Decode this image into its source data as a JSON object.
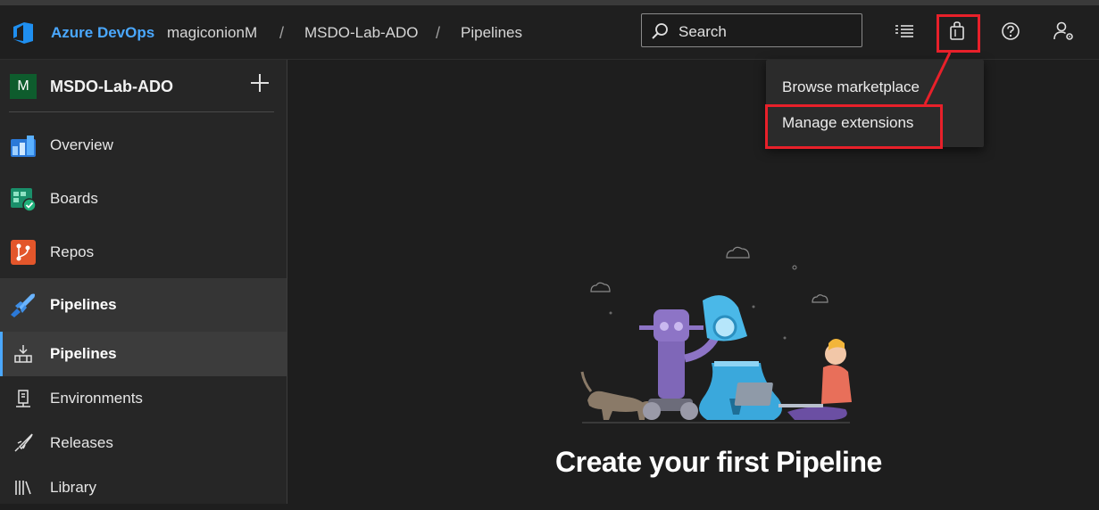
{
  "header": {
    "brand": "Azure DevOps",
    "breadcrumb": [
      "magiconionM",
      "MSDO-Lab-ADO",
      "Pipelines"
    ],
    "search_placeholder": "Search",
    "icons": [
      "task-list-icon",
      "marketplace-bag-icon",
      "help-icon",
      "user-settings-icon"
    ]
  },
  "menu": {
    "items": [
      "Browse marketplace",
      "Manage extensions"
    ]
  },
  "sidebar": {
    "project_initial": "M",
    "project_name": "MSDO-Lab-ADO",
    "items": [
      {
        "label": "Overview",
        "icon": "overview-icon"
      },
      {
        "label": "Boards",
        "icon": "boards-icon"
      },
      {
        "label": "Repos",
        "icon": "repos-icon"
      },
      {
        "label": "Pipelines",
        "icon": "pipelines-icon"
      }
    ],
    "subitems": [
      {
        "label": "Pipelines",
        "icon": "pipelines-sub-icon"
      },
      {
        "label": "Environments",
        "icon": "environments-icon"
      },
      {
        "label": "Releases",
        "icon": "releases-icon"
      },
      {
        "label": "Library",
        "icon": "library-icon"
      }
    ]
  },
  "main": {
    "headline": "Create your first Pipeline"
  },
  "colors": {
    "accent": "#4aa8ff",
    "highlight": "#e8202a",
    "project_avatar": "#0e5c2d"
  }
}
